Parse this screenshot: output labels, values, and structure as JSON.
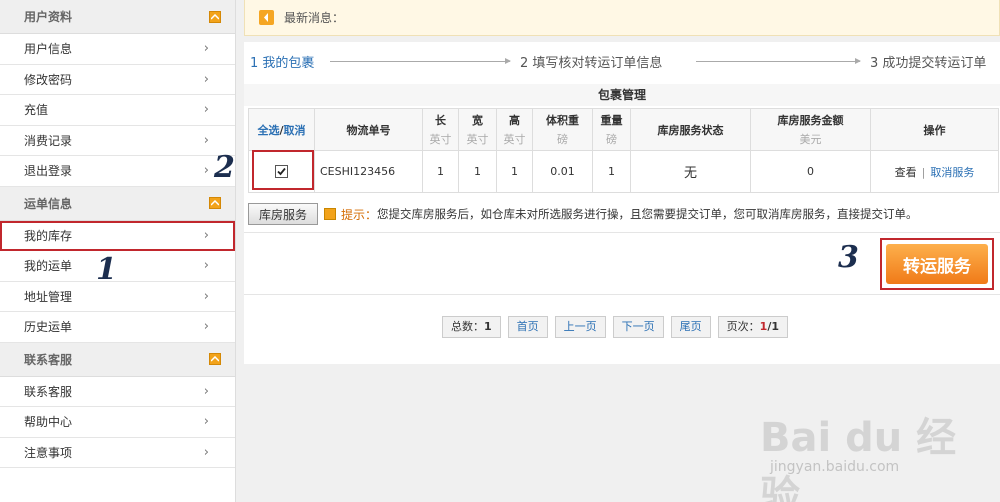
{
  "sidebar": {
    "sections": [
      {
        "title": "用户资料",
        "items": [
          "用户信息",
          "修改密码",
          "充值",
          "消费记录",
          "退出登录"
        ]
      },
      {
        "title": "运单信息",
        "items": [
          "我的库存",
          "我的运单",
          "地址管理",
          "历史运单"
        ]
      },
      {
        "title": "联系客服",
        "items": [
          "联系客服",
          "帮助中心",
          "注意事项"
        ]
      }
    ]
  },
  "notice": {
    "label": "最新消息："
  },
  "steps": [
    "1 我的包裹",
    "2 填写核对转运订单信息",
    "3 成功提交转运订单"
  ],
  "table": {
    "title": "包裹管理",
    "select_all": "全选",
    "select_sep": "/",
    "select_cancel": "取消",
    "headers": [
      {
        "name": "物流单号",
        "unit": ""
      },
      {
        "name": "长",
        "unit": "英寸"
      },
      {
        "name": "宽",
        "unit": "英寸"
      },
      {
        "name": "高",
        "unit": "英寸"
      },
      {
        "name": "体积重",
        "unit": "磅"
      },
      {
        "name": "重量",
        "unit": "磅"
      },
      {
        "name": "库房服务状态",
        "unit": ""
      },
      {
        "name": "库房服务金额",
        "unit": "美元"
      },
      {
        "name": "操作",
        "unit": ""
      }
    ],
    "rows": [
      {
        "tracking": "CESHI123456",
        "length": "1",
        "width": "1",
        "height": "1",
        "vol_weight": "0.01",
        "weight": "1",
        "status": "无",
        "amount": "0",
        "view": "查看",
        "sep": "|",
        "cancel": "取消服务",
        "checked": true
      }
    ]
  },
  "tip": {
    "button": "库房服务",
    "label": "提示：",
    "text": "您提交库房服务后，如仓库未对所选服务进行操，且您需要提交订单，您可取消库房服务，直接提交订单。"
  },
  "transfer_button": "转运服务",
  "pager": {
    "total_label": "总数：",
    "total": "1",
    "first": "首页",
    "prev": "上一页",
    "next": "下一页",
    "last": "尾页",
    "page_label": "页次：",
    "page_current": "1",
    "page_total": "/1"
  },
  "annotations": [
    "1",
    "2",
    "3"
  ],
  "watermark": {
    "brand": "Bai du 经验",
    "url": "jingyan.baidu.com"
  },
  "colors": {
    "accent": "#2b70b4",
    "highlight": "#c1272d",
    "orange": "#f07a18"
  }
}
